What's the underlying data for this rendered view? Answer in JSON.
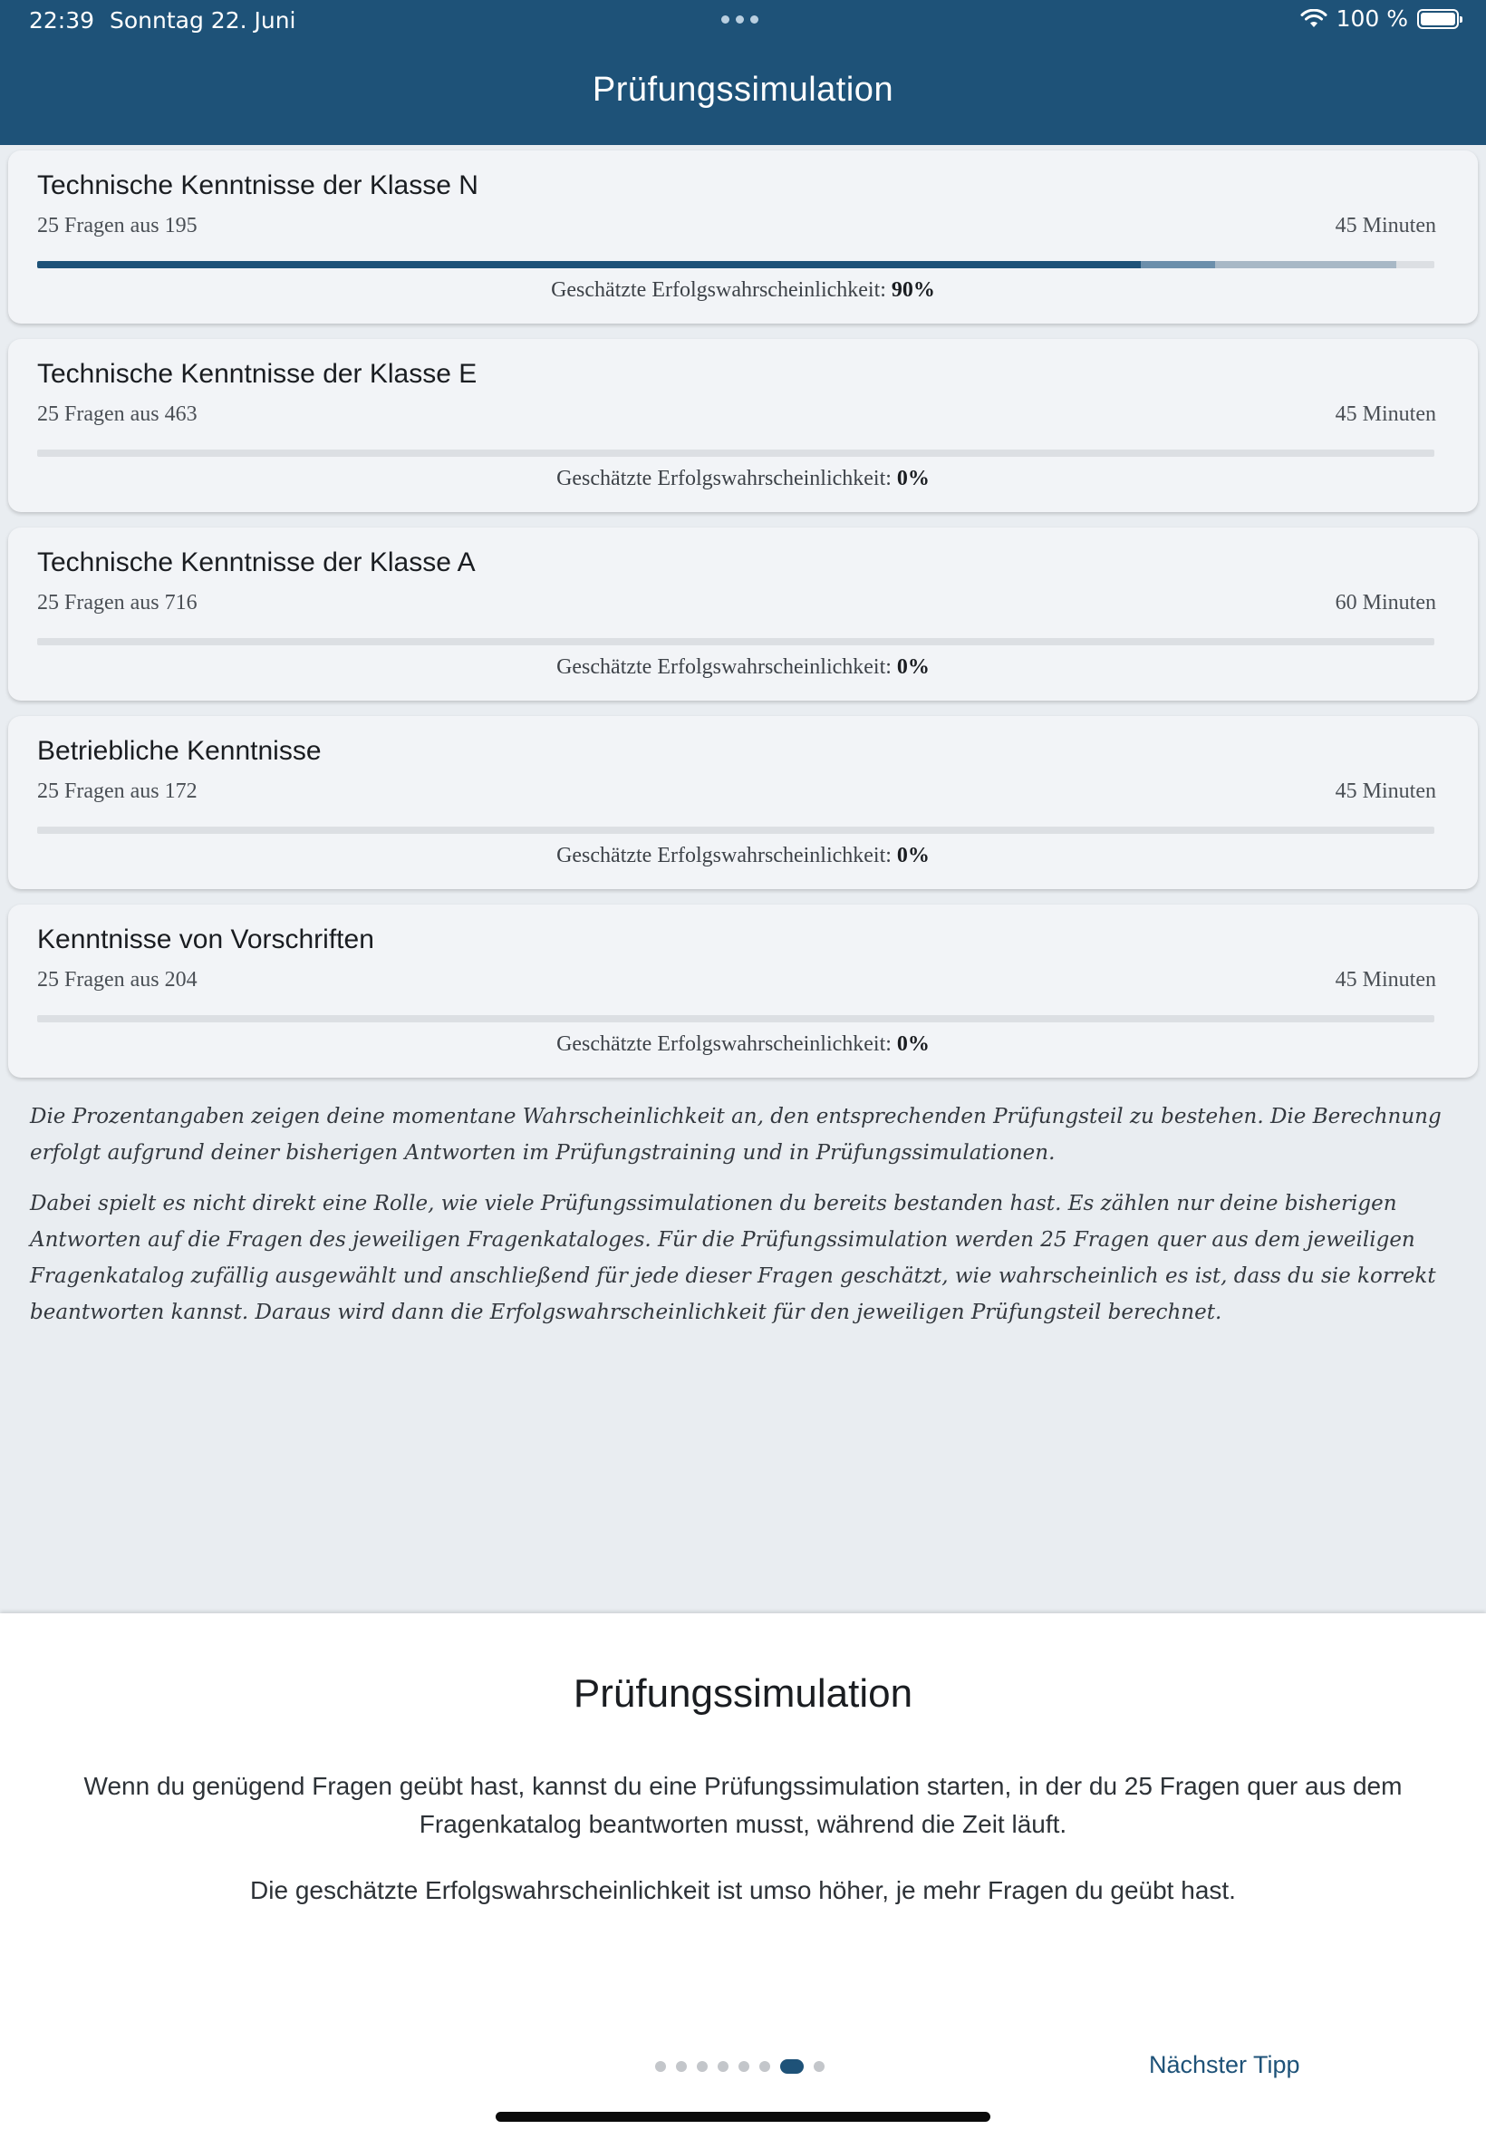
{
  "status_bar": {
    "time": "22:39",
    "date": "Sonntag 22. Juni",
    "battery": "100 %",
    "wifi_icon": "wifi-icon",
    "battery_icon": "battery-icon"
  },
  "header": {
    "title": "Prüfungssimulation"
  },
  "colors": {
    "header": "#1e5278",
    "accent": "#1e5278",
    "segment_mid": "#6c8fab",
    "segment_light": "#a8b8c6"
  },
  "cards": [
    {
      "title": "Technische Kenntnisse der Klasse N",
      "subtitle": "25 Fragen aus 195",
      "duration": "45 Minuten",
      "prob_label": "Geschätzte Erfolgswahrscheinlichkeit:",
      "prob_value": "90%",
      "progress_segments": [
        0.79,
        0.053,
        0.13,
        0.027
      ]
    },
    {
      "title": "Technische Kenntnisse der Klasse E",
      "subtitle": "25 Fragen aus 463",
      "duration": "45 Minuten",
      "prob_label": "Geschätzte Erfolgswahrscheinlichkeit:",
      "prob_value": "0%",
      "progress_segments": [
        0,
        0,
        0,
        0
      ]
    },
    {
      "title": "Technische Kenntnisse der Klasse A",
      "subtitle": "25 Fragen aus 716",
      "duration": "60 Minuten",
      "prob_label": "Geschätzte Erfolgswahrscheinlichkeit:",
      "prob_value": "0%",
      "progress_segments": [
        0,
        0,
        0,
        0
      ]
    },
    {
      "title": "Betriebliche Kenntnisse",
      "subtitle": "25 Fragen aus 172",
      "duration": "45 Minuten",
      "prob_label": "Geschätzte Erfolgswahrscheinlichkeit:",
      "prob_value": "0%",
      "progress_segments": [
        0,
        0,
        0,
        0
      ]
    },
    {
      "title": "Kenntnisse von Vorschriften",
      "subtitle": "25 Fragen aus 204",
      "duration": "45 Minuten",
      "prob_label": "Geschätzte Erfolgswahrscheinlichkeit:",
      "prob_value": "0%",
      "progress_segments": [
        0,
        0,
        0,
        0
      ]
    }
  ],
  "explanation": {
    "p1": "Die Prozentangaben zeigen deine momentane Wahrscheinlichkeit an, den entsprechenden Prüfungsteil zu bestehen. Die Berechnung erfolgt aufgrund deiner bisherigen Antworten im Prüfungstraining und in Prüfungssimulationen.",
    "p2": "Dabei spielt es nicht direkt eine Rolle, wie viele Prüfungssimulationen du bereits bestanden hast. Es zählen nur deine bisherigen Antworten auf die Fragen des jeweiligen Fragenkataloges. Für die Prüfungssimulation werden 25 Fragen quer aus dem jeweiligen Fragenkatalog zufällig ausgewählt und anschließend für jede dieser Fragen geschätzt, wie wahrscheinlich es ist, dass du sie korrekt beantworten kannst. Daraus wird dann die Erfolgswahrscheinlichkeit für den jeweiligen Prüfungsteil berechnet."
  },
  "tip_sheet": {
    "title": "Prüfungssimulation",
    "p1": "Wenn du genügend Fragen geübt hast, kannst du eine Prüfungssimulation starten, in der du 25 Fragen quer aus dem Fragenkatalog beantworten musst, während die Zeit läuft.",
    "p2": "Die geschätzte Erfolgswahrscheinlichkeit ist umso höher, je mehr Fragen du geübt hast.",
    "page_count": 8,
    "active_page": 7,
    "next_label": "Nächster Tipp"
  }
}
